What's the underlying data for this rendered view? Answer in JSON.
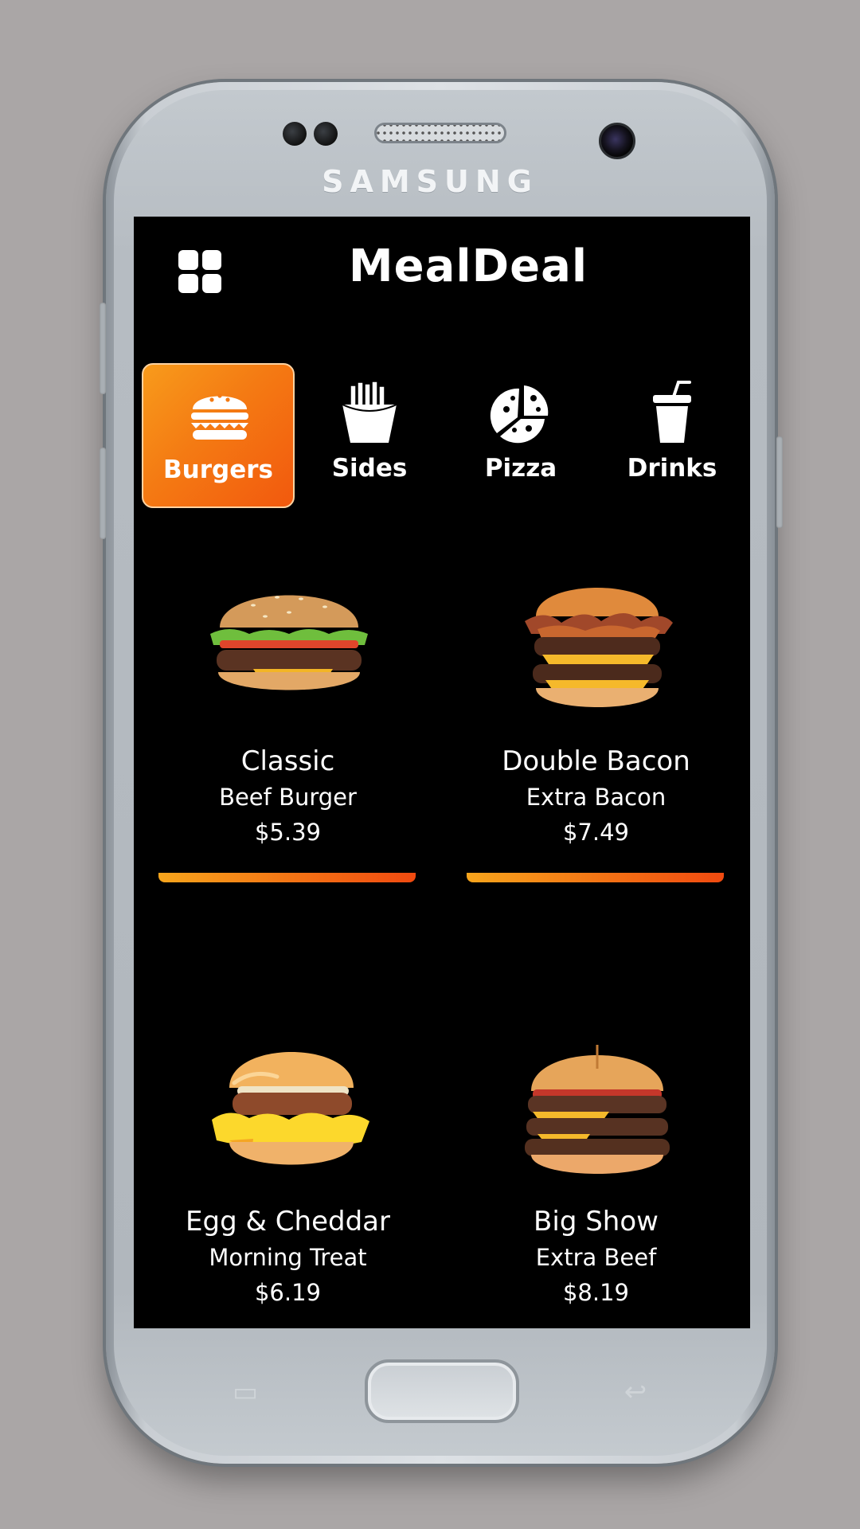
{
  "device": {
    "brand": "SAMSUNG"
  },
  "header": {
    "menu_icon": "grid-menu-icon",
    "title": "MealDeal"
  },
  "categories": [
    {
      "label": "Burgers",
      "icon": "burger-icon",
      "active": true
    },
    {
      "label": "Sides",
      "icon": "fries-icon",
      "active": false
    },
    {
      "label": "Pizza",
      "icon": "pizza-icon",
      "active": false
    },
    {
      "label": "Drinks",
      "icon": "drink-cup-icon",
      "active": false
    }
  ],
  "products": [
    {
      "name": "Classic",
      "subtitle": "Beef Burger",
      "price": "$5.39",
      "image": "classic-burger-image"
    },
    {
      "name": "Double Bacon",
      "subtitle": "Extra Bacon",
      "price": "$7.49",
      "image": "double-bacon-burger-image"
    },
    {
      "name": "Egg & Cheddar",
      "subtitle": "Morning Treat",
      "price": "$6.19",
      "image": "egg-cheddar-burger-image"
    },
    {
      "name": "Big Show",
      "subtitle": "Extra Beef",
      "price": "$8.19",
      "image": "big-show-burger-image"
    }
  ],
  "colors": {
    "accent_start": "#f89b1b",
    "accent_end": "#f04a10",
    "screen_bg": "#000000",
    "text": "#ffffff"
  }
}
